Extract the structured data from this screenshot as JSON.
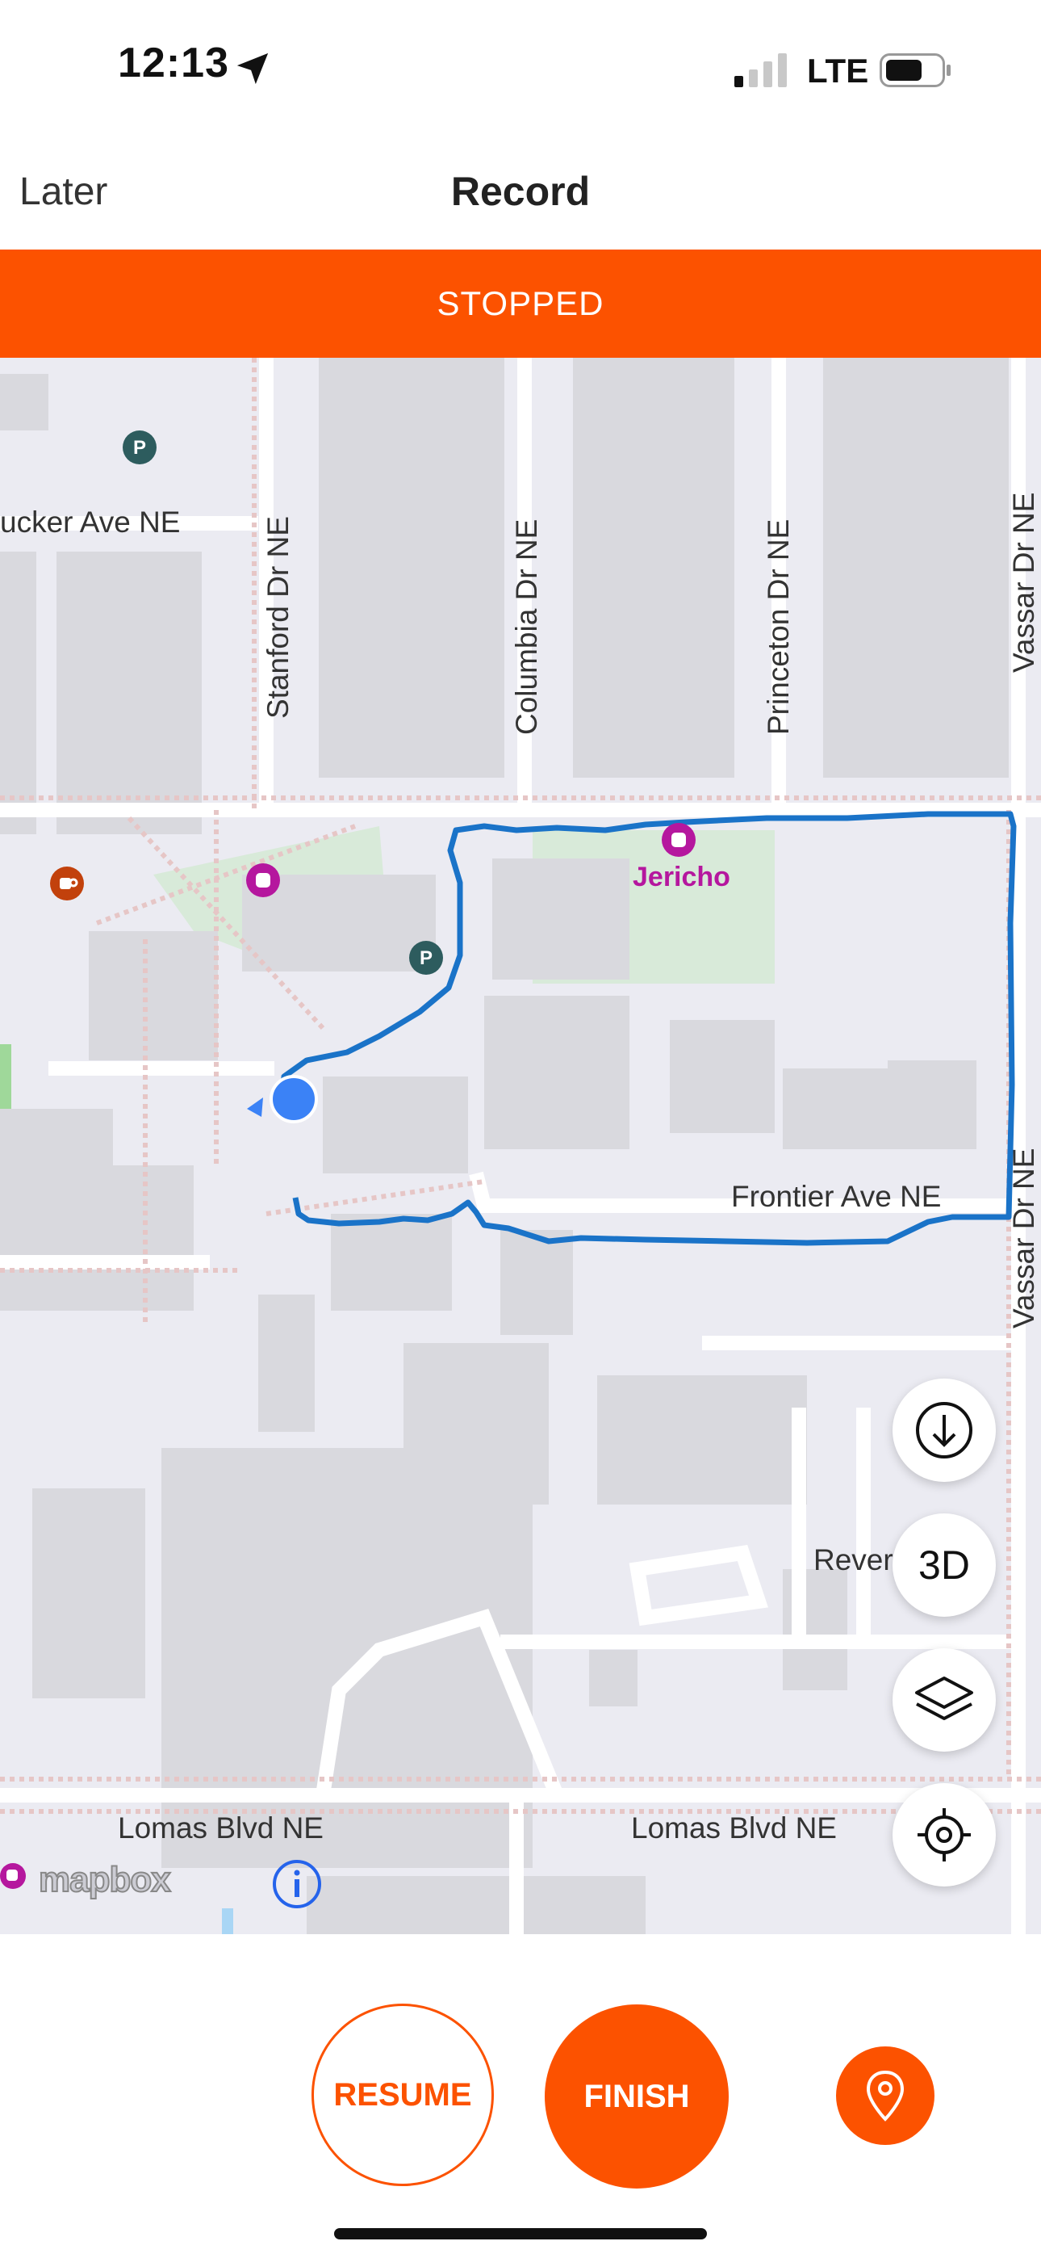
{
  "status_bar": {
    "time": "12:13",
    "network": "LTE",
    "icons": [
      "location-arrow-icon",
      "signal-icon",
      "battery-icon"
    ]
  },
  "nav": {
    "back_label": "Later",
    "title": "Record"
  },
  "banner": {
    "text": "STOPPED",
    "color": "#fc5200"
  },
  "map": {
    "streets": {
      "tucker": "ucker Ave NE",
      "stanford": "Stanford Dr NE",
      "columbia": "Columbia Dr NE",
      "princeton": "Princeton Dr NE",
      "vassar_top": "Vassar Dr NE",
      "vassar_bottom": "Vassar Dr NE",
      "frontier": "Frontier Ave NE",
      "redondo": "Revere",
      "lomas_left": "Lomas Blvd NE",
      "lomas_right": "Lomas Blvd NE"
    },
    "poi_label": "Jericho",
    "attribution": "mapbox",
    "route_color": "#1a73c8",
    "location_color": "#3b82f6"
  },
  "map_controls": {
    "download_icon": "download-icon",
    "three_d_label": "3D",
    "layers_icon": "layers-icon",
    "recenter_icon": "crosshair-icon"
  },
  "controls": {
    "resume_label": "RESUME",
    "finish_label": "FINISH",
    "pin_icon": "map-pin-icon",
    "accent": "#fc5200"
  }
}
